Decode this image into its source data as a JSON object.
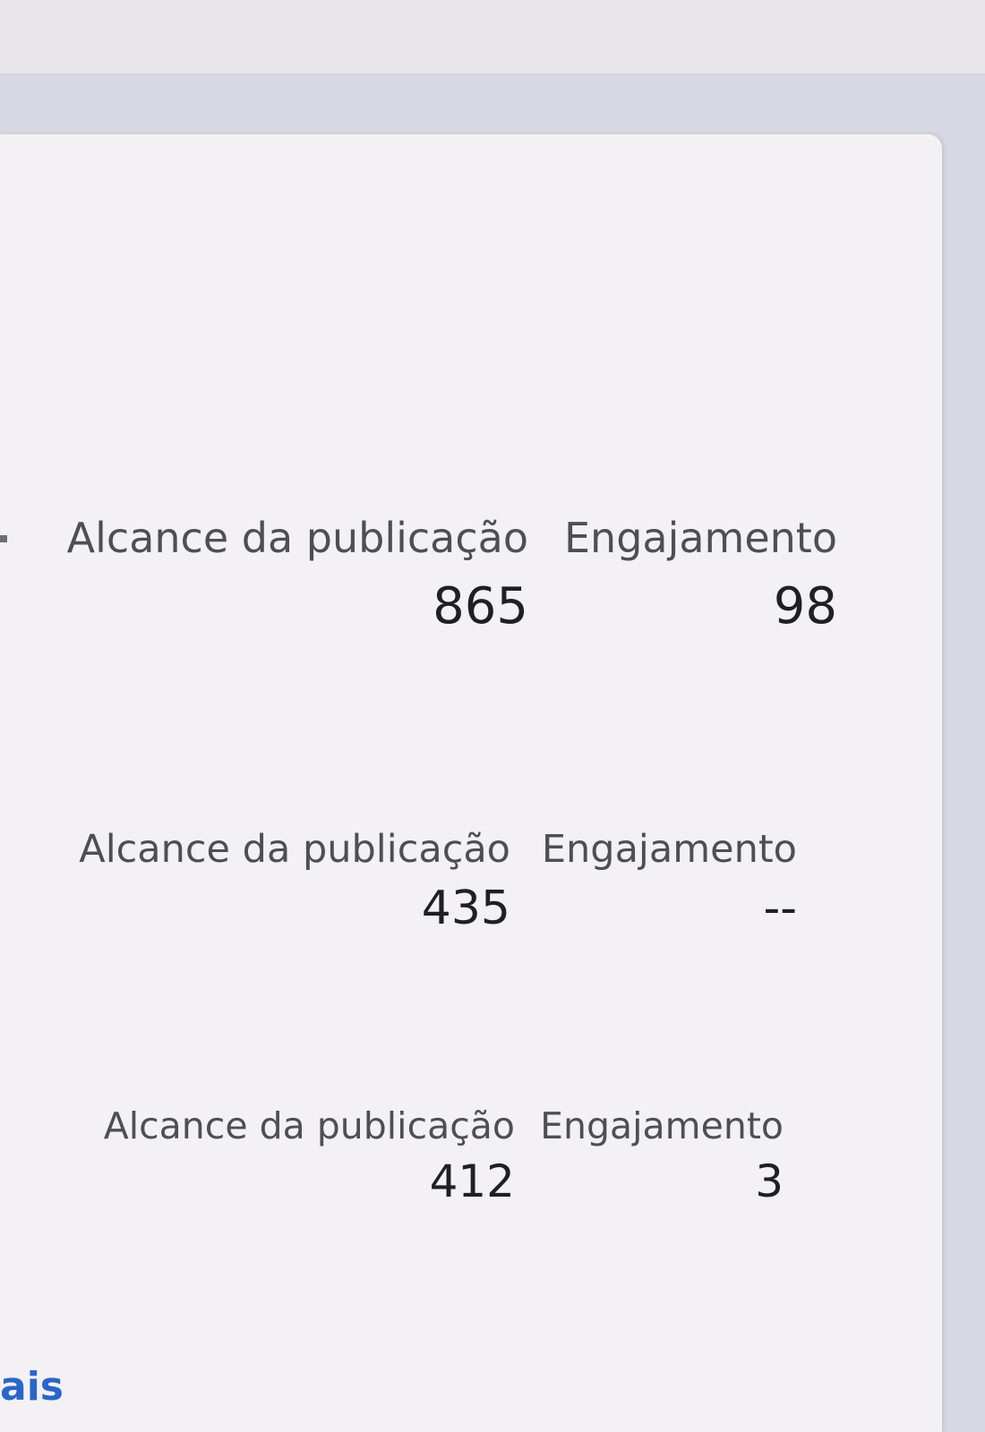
{
  "stats": [
    {
      "reach_label": "Alcance da publicação",
      "reach_value": "865",
      "engagement_label": "Engajamento",
      "engagement_value": "98"
    },
    {
      "reach_label": "Alcance da publicação",
      "reach_value": "435",
      "engagement_label": "Engajamento",
      "engagement_value": "--"
    },
    {
      "reach_label": "Alcance da publicação",
      "reach_value": "412",
      "engagement_label": "Engajamento",
      "engagement_value": "3"
    }
  ],
  "footer": {
    "link_text": "ais"
  }
}
